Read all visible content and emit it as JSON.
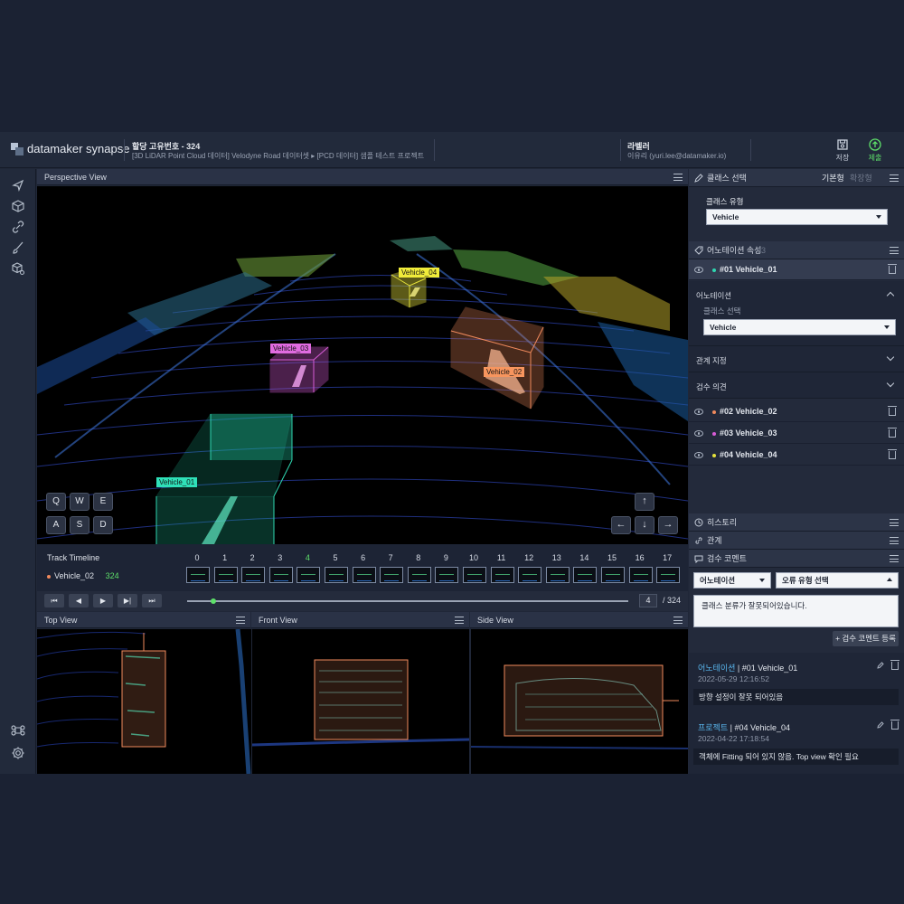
{
  "header": {
    "logo": "datamaker synapse",
    "title": "할당 고유번호 - 324",
    "subtitle": "[3D LiDAR Point Cloud 데이터] Velodyne Road 데이터셋 ▸ [PCD 데이터] 샘플 테스트 프로젝트",
    "user_role": "라벨러",
    "user_name": "이유리 (yuri.lee@datamaker.io)",
    "save_label": "저장",
    "submit_label": "제출"
  },
  "perspective": {
    "title": "Perspective View",
    "labels": {
      "v01": "Vehicle_01",
      "v02": "Vehicle_02",
      "v03": "Vehicle_03",
      "v04": "Vehicle_04"
    },
    "keys": [
      "Q",
      "W",
      "E",
      "A",
      "S",
      "D"
    ],
    "arrows": [
      "↑",
      "←",
      "↓",
      "→"
    ]
  },
  "timeline": {
    "label": "Track Timeline",
    "track_name": "Vehicle_02",
    "track_id": "324",
    "frames": [
      "0",
      "1",
      "2",
      "3",
      "4",
      "5",
      "6",
      "7",
      "8",
      "9",
      "10",
      "11",
      "12",
      "13",
      "14",
      "15",
      "16",
      "17"
    ],
    "active_frame": "4"
  },
  "player": {
    "buttons": [
      "⏮",
      "◀",
      "▶",
      "▶|",
      "⏭"
    ],
    "current": "4",
    "total": "/ 324",
    "progress": 0.012
  },
  "views": {
    "top": "Top View",
    "front": "Front View",
    "side": "Side View"
  },
  "right": {
    "class_section": {
      "title": "클래스 선택",
      "tab_basic": "기본형",
      "tab_extended": "확장형",
      "type_label": "클래스 유형",
      "type_value": "Vehicle"
    },
    "annotation_section": {
      "title": "어노테이션 속성",
      "count": "03"
    },
    "objects": [
      {
        "label": "#01 Vehicle_01",
        "color": "#2fd6b0"
      },
      {
        "label": "#02 Vehicle_02",
        "color": "#f08a5d"
      },
      {
        "label": "#03 Vehicle_03",
        "color": "#d75cd6"
      },
      {
        "label": "#04 Vehicle_04",
        "color": "#e5e23c"
      }
    ],
    "annotation_detail": {
      "label": "어노테이션",
      "class_label": "클래스 선택",
      "class_value": "Vehicle"
    },
    "relation_label": "관계 지정",
    "review_label": "검수 의견",
    "history": "히스토리",
    "relations": "관계",
    "review_comment": "검수 코멘트",
    "comment_form": {
      "type_value": "어노테이션",
      "error_value": "오류 유형 선택",
      "text": "클래스 분류가 잘못되어있습니다.",
      "register": "+ 검수 코멘트 등록"
    },
    "comments": [
      {
        "title_prefix": "어노테이션",
        "title_obj": " | #01 Vehicle_01",
        "date": "2022-05-29 12:16:52",
        "body": "방향 설정이 잘못 되어있음"
      },
      {
        "title_prefix": "프로젝트",
        "title_obj": " | #04 Vehicle_04",
        "date": "2022-04-22 17:18:54",
        "body": "객체에 Fitting 되어 있지 않음. Top view 확인 필요"
      }
    ]
  }
}
